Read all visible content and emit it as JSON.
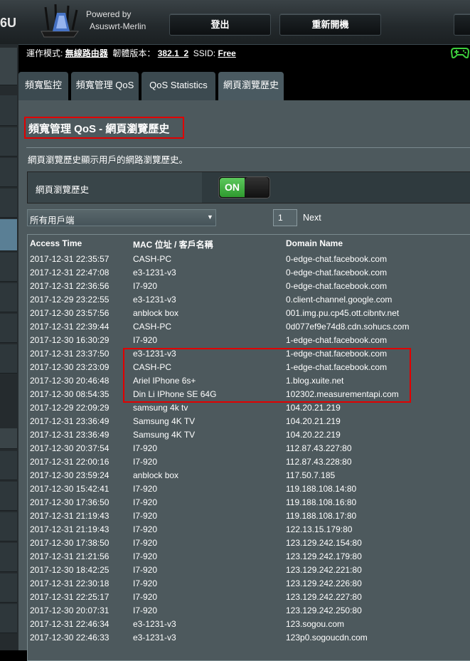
{
  "header": {
    "brand_suffix": "6U",
    "powered_by": "Powered by",
    "firmware_name": "Asuswrt-Merlin",
    "logout_label": "登出",
    "reboot_label": "重新開機"
  },
  "status": {
    "mode_label": "運作模式:",
    "mode_value": "無線路由器",
    "fw_label": "韌體版本：",
    "fw_value": "382.1_2",
    "ssid_label": "SSID:",
    "ssid_value": "Free"
  },
  "tabs": [
    {
      "label": "頻寬監控"
    },
    {
      "label": "頻寬管理 QoS"
    },
    {
      "label": "QoS Statistics"
    },
    {
      "label": "網頁瀏覽歷史"
    }
  ],
  "page": {
    "title": "頻寬管理 QoS - 網頁瀏覽歷史",
    "description": "網頁瀏覽歷史顯示用戶的網路瀏覽歷史。",
    "toggle_label": "網頁瀏覽歷史",
    "toggle_state": "ON",
    "client_filter": "所有用戶端",
    "page_number": "1",
    "next_label": "Next"
  },
  "table": {
    "headers": [
      "Access Time",
      "MAC 位址 / 客戶名稱",
      "Domain Name"
    ],
    "rows": [
      [
        "2017-12-31  22:35:57",
        "CASH-PC",
        "0-edge-chat.facebook.com"
      ],
      [
        "2017-12-31  22:47:08",
        "e3-1231-v3",
        "0-edge-chat.facebook.com"
      ],
      [
        "2017-12-31  22:36:56",
        "I7-920",
        "0-edge-chat.facebook.com"
      ],
      [
        "2017-12-29  23:22:55",
        "e3-1231-v3",
        "0.client-channel.google.com"
      ],
      [
        "2017-12-30  23:57:56",
        "anblock box",
        "001.img.pu.cp45.ott.cibntv.net"
      ],
      [
        "2017-12-31  22:39:44",
        "CASH-PC",
        "0d077ef9e74d8.cdn.sohucs.com"
      ],
      [
        "2017-12-30  16:30:29",
        "I7-920",
        "1-edge-chat.facebook.com"
      ],
      [
        "2017-12-31  23:37:50",
        "e3-1231-v3",
        "1-edge-chat.facebook.com"
      ],
      [
        "2017-12-30  23:23:09",
        "CASH-PC",
        "1-edge-chat.facebook.com"
      ],
      [
        "2017-12-30  20:46:48",
        "Ariel IPhone 6s+",
        "1.blog.xuite.net"
      ],
      [
        "2017-12-30  08:54:35",
        "Din Li IPhone SE 64G",
        "102302.measurementapi.com"
      ],
      [
        "2017-12-29  22:09:29",
        "samsung 4k tv",
        "104.20.21.219"
      ],
      [
        "2017-12-31  23:36:49",
        "Samsung 4K TV",
        "104.20.21.219"
      ],
      [
        "2017-12-31  23:36:49",
        "Samsung 4K TV",
        "104.20.22.219"
      ],
      [
        "2017-12-30  20:37:54",
        "I7-920",
        "112.87.43.227:80"
      ],
      [
        "2017-12-31  22:00:16",
        "I7-920",
        "112.87.43.228:80"
      ],
      [
        "2017-12-30  23:59:24",
        "anblock box",
        "117.50.7.185"
      ],
      [
        "2017-12-30  15:42:41",
        "I7-920",
        "119.188.108.14:80"
      ],
      [
        "2017-12-30  17:36:50",
        "I7-920",
        "119.188.108.16:80"
      ],
      [
        "2017-12-31  21:19:43",
        "I7-920",
        "119.188.108.17:80"
      ],
      [
        "2017-12-31  21:19:43",
        "I7-920",
        "122.13.15.179:80"
      ],
      [
        "2017-12-30  17:38:50",
        "I7-920",
        "123.129.242.154:80"
      ],
      [
        "2017-12-31  21:21:56",
        "I7-920",
        "123.129.242.179:80"
      ],
      [
        "2017-12-30  18:42:25",
        "I7-920",
        "123.129.242.221:80"
      ],
      [
        "2017-12-31  22:30:18",
        "I7-920",
        "123.129.242.226:80"
      ],
      [
        "2017-12-31  22:25:17",
        "I7-920",
        "123.129.242.227:80"
      ],
      [
        "2017-12-30  20:07:31",
        "I7-920",
        "123.129.242.250:80"
      ],
      [
        "2017-12-31  22:46:34",
        "e3-1231-v3",
        "123.sogou.com"
      ],
      [
        "2017-12-30  22:46:33",
        "e3-1231-v3",
        "123p0.sogoucdn.com"
      ]
    ]
  },
  "colors": {
    "panel_bg": "#4d595d",
    "highlight_red": "#e10000",
    "toggle_green": "#3fb03f",
    "gamepad_green": "#3dcf3d"
  },
  "icons": [
    "router-logo-icon",
    "gamepad-icon",
    "dropdown-arrow-icon"
  ]
}
